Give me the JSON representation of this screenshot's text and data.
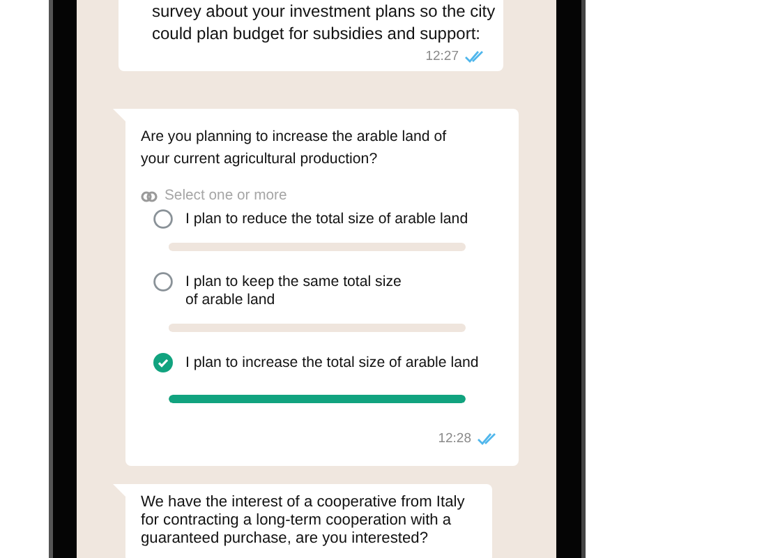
{
  "messages": [
    {
      "kind": "text",
      "lines": [
        "survey about your investment plans so the city",
        "could plan budget for subsidies and support:"
      ],
      "time": "12:27",
      "read": true
    },
    {
      "kind": "poll",
      "question": "Are you planning to increase the arable land of your current agricultural production?",
      "hint": "Select one or more",
      "options": [
        {
          "label": "I plan to reduce the total size of arable land",
          "selected": false,
          "level": 0
        },
        {
          "label": "I plan to keep the same total size\nof arable land",
          "selected": false,
          "level": 0
        },
        {
          "label": "I plan to increase the total size of arable land",
          "selected": true,
          "level": 1
        }
      ],
      "time": "12:28",
      "read": true
    },
    {
      "kind": "incoming",
      "lines": [
        "We have the interest of a cooperative from Italy",
        "for contracting a long-term cooperation with a",
        "guaranteed purchase, are you interested?"
      ]
    }
  ]
}
